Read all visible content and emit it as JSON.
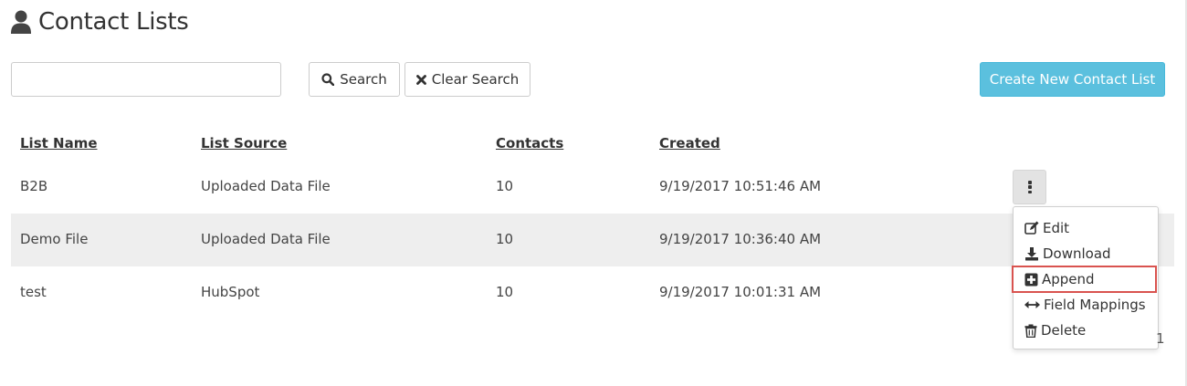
{
  "page": {
    "title": "Contact Lists"
  },
  "search": {
    "placeholder": "",
    "value": "",
    "search_label": "Search",
    "clear_label": "Clear Search"
  },
  "actions": {
    "create_label": "Create New Contact List"
  },
  "table": {
    "columns": [
      "List Name",
      "List Source",
      "Contacts",
      "Created"
    ],
    "rows": [
      {
        "name": "B2B",
        "source": "Uploaded Data File",
        "contacts": "10",
        "created": "9/19/2017 10:51:46 AM"
      },
      {
        "name": "Demo File",
        "source": "Uploaded Data File",
        "contacts": "10",
        "created": "9/19/2017 10:36:40 AM"
      },
      {
        "name": "test",
        "source": "HubSpot",
        "contacts": "10",
        "created": "9/19/2017 10:01:31 AM"
      }
    ]
  },
  "row_menu": {
    "items": [
      "Edit",
      "Download",
      "Append",
      "Field Mappings",
      "Delete"
    ],
    "highlighted": "Append"
  },
  "pagination": {
    "current": "1"
  },
  "colors": {
    "primary_info": "#5bc0de",
    "highlight": "#d9534f",
    "stripe": "#eeeeee"
  },
  "icons": {
    "title": "user-icon",
    "search": "search-icon",
    "clear": "close-icon",
    "row_actions": "vertical-ellipsis-icon",
    "edit": "edit-icon",
    "download": "download-icon",
    "append": "plus-square-icon",
    "field_mappings": "arrows-horizontal-icon",
    "delete": "trash-icon"
  }
}
